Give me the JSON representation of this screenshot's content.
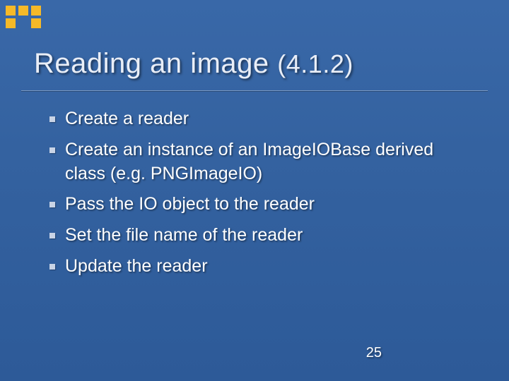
{
  "title_main": "Reading an image ",
  "title_version": "(4.1.2)",
  "bullets": [
    "Create a reader",
    "Create an instance of an ImageIOBase derived class (e.g. PNGImageIO)",
    "Pass the IO object to the reader",
    "Set the file name of the reader",
    "Update the reader"
  ],
  "page_number": "25"
}
